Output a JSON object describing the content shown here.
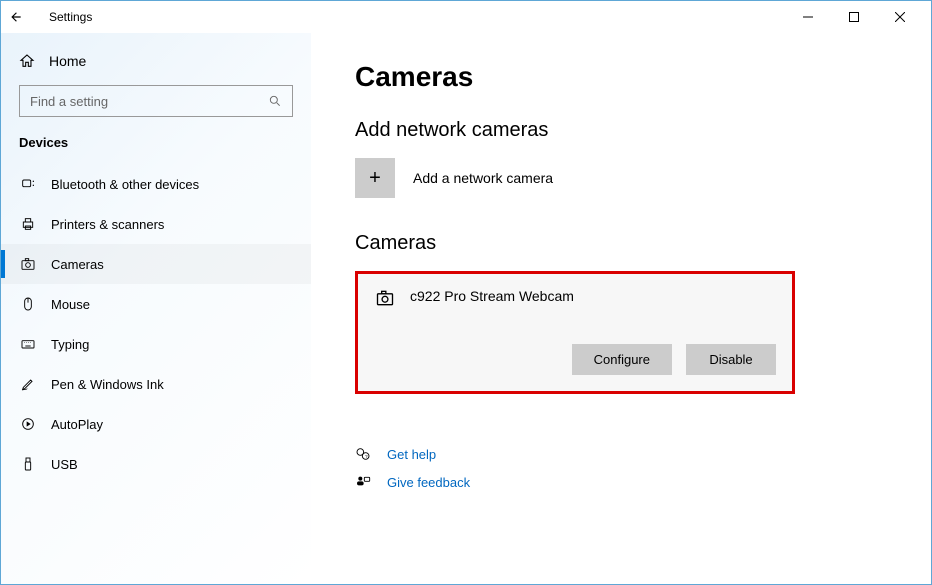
{
  "window": {
    "title": "Settings"
  },
  "sidebar": {
    "home": "Home",
    "search_placeholder": "Find a setting",
    "group": "Devices",
    "items": [
      {
        "label": "Bluetooth & other devices"
      },
      {
        "label": "Printers & scanners"
      },
      {
        "label": "Cameras"
      },
      {
        "label": "Mouse"
      },
      {
        "label": "Typing"
      },
      {
        "label": "Pen & Windows Ink"
      },
      {
        "label": "AutoPlay"
      },
      {
        "label": "USB"
      }
    ]
  },
  "page": {
    "title": "Cameras",
    "section_add": "Add network cameras",
    "add_label": "Add a network camera",
    "section_cameras": "Cameras",
    "camera_name": "c922 Pro Stream Webcam",
    "btn_configure": "Configure",
    "btn_disable": "Disable",
    "help": "Get help",
    "feedback": "Give feedback"
  }
}
